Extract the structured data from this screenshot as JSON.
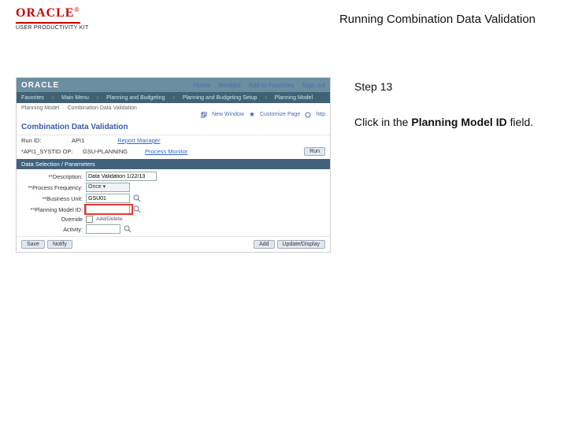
{
  "header": {
    "brand": "ORACLE",
    "upk": "USER PRODUCTIVITY KIT",
    "title": "Running Combination Data Validation"
  },
  "instructions": {
    "step_label": "Step 13",
    "text_pre": "Click in the ",
    "text_bold": "Planning Model ID",
    "text_post": " field."
  },
  "shot": {
    "brand": "ORACLE",
    "menu": [
      "Favorites",
      "Main Menu",
      "Planning and Budgeting",
      "Planning and Budgeting Setup",
      "Planning Model"
    ],
    "right_links": [
      "Home",
      "Worklist",
      "Add to Favorites",
      "Sign out"
    ],
    "crumb_items": [
      "Planning Model",
      "Combination Data Validation"
    ],
    "toolbar": {
      "new_window": "New Window",
      "customize": "Customize Page",
      "http": "http"
    },
    "page_title": "Combination Data Validation",
    "run_row": {
      "label_l": "Run ID:",
      "value_l": "API1",
      "link_m": "Report Manager",
      "link_r": "Process Monitor",
      "run_btn": "Run"
    },
    "busunit_row": {
      "label": "*API1_SYSTID  OP:",
      "value": "GSU-PLANNING"
    },
    "sub_header": "Data Selection / Parameters",
    "params": {
      "desc_label": "*Description:",
      "desc_value": "Data Validation 1/22/13",
      "scenset_label": "*Process Frequency:",
      "scenset_value": "Once",
      "busunit_label": "*Business Unit:",
      "busunit_value": "GSU01",
      "plmodel_label": "*Planning Model ID:",
      "plmodel_value": "",
      "override_label": "Override",
      "override_badge": "Add/Delete",
      "activity_label": "Activity:"
    },
    "bottom": {
      "save": "Save",
      "notify": "Notify",
      "add": "Add",
      "update": "Update/Display"
    }
  }
}
